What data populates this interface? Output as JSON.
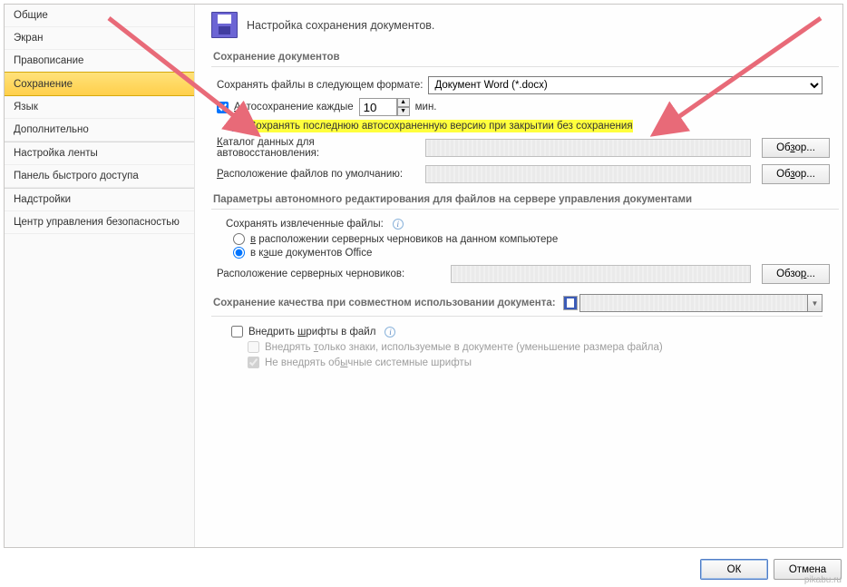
{
  "sidebar": {
    "items": [
      {
        "label": "Общие"
      },
      {
        "label": "Экран"
      },
      {
        "label": "Правописание"
      },
      {
        "label": "Сохранение",
        "selected": true
      },
      {
        "label": "Язык"
      },
      {
        "label": "Дополнительно"
      },
      {
        "label": "Настройка ленты"
      },
      {
        "label": "Панель быстрого доступа"
      },
      {
        "label": "Надстройки"
      },
      {
        "label": "Центр управления безопасностью"
      }
    ]
  },
  "header": {
    "title": "Настройка сохранения документов."
  },
  "section_save_docs": {
    "header": "Сохранение документов",
    "format_label": "Сохранять файлы в следующем формате:",
    "format_value": "Документ Word (*.docx)",
    "autosave_label_prefix": "Автосохранение каждые",
    "autosave_value": "10",
    "autosave_label_suffix": "мин.",
    "keep_last_label": "Сохранять последнюю автосохраненную версию при закрытии без сохранения",
    "autorecovery_label": "Каталог данных для автовосстановления:",
    "default_loc_label": "Расположение файлов по умолчанию:",
    "browse": "Обзор..."
  },
  "section_offline": {
    "header": "Параметры автономного редактирования для файлов на сервере управления документами",
    "save_checked_out_label": "Сохранять извлеченные файлы:",
    "option_server_drafts": "в расположении серверных черновиков на данном компьютере",
    "option_office_cache": "в кэше документов Office",
    "server_drafts_loc_label": "Расположение серверных черновиков:",
    "browse": "Обзор..."
  },
  "section_quality": {
    "header": "Сохранение качества при совместном использовании документа:",
    "embed_fonts_label": "Внедрить шрифты в файл",
    "embed_used_chars_label": "Внедрять только знаки, используемые в документе (уменьшение размера файла)",
    "skip_system_fonts_label": "Не внедрять обычные системные шрифты"
  },
  "buttons": {
    "ok": "ОК",
    "cancel": "Отмена"
  },
  "watermark": "pikabu.ru",
  "keys": {
    "A": "А",
    "S": "С",
    "R": "Р",
    "v": "в",
    "e": "э",
    "sh": "ш",
    "t": "т",
    "y": "ы",
    "z": "з"
  }
}
